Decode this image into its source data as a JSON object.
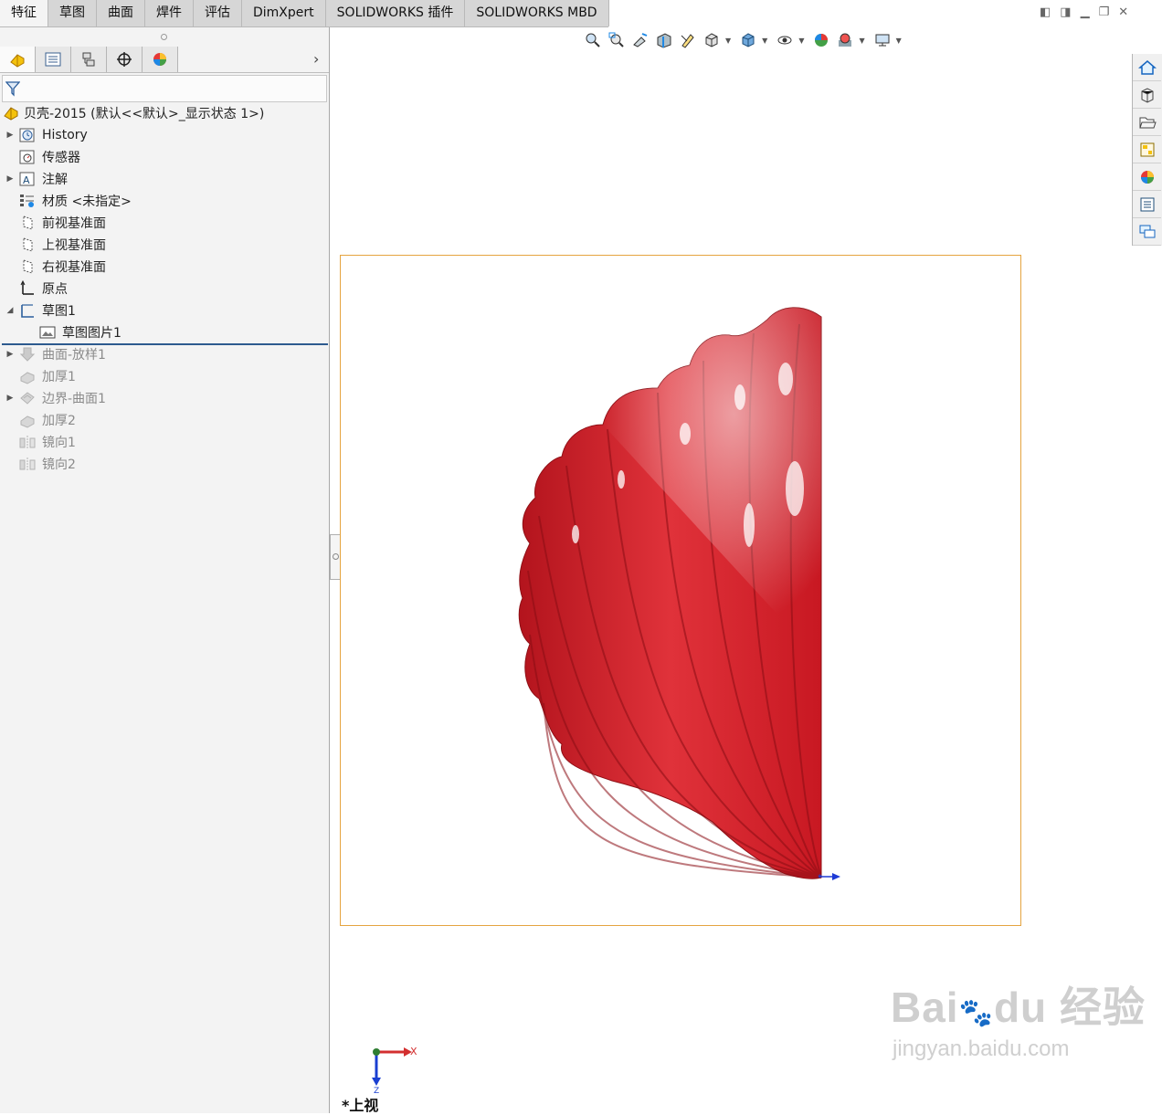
{
  "tabs": [
    "特征",
    "草图",
    "曲面",
    "焊件",
    "评估",
    "DimXpert",
    "SOLIDWORKS 插件",
    "SOLIDWORKS MBD"
  ],
  "active_tab": "特征",
  "panel_tabs": [
    "feature-manager-icon",
    "property-manager-icon",
    "configuration-manager-icon",
    "dimxpert-manager-icon",
    "display-manager-icon"
  ],
  "panel_expand_glyph": "›",
  "tree": {
    "root": "贝壳-2015  (默认<<默认>_显示状态 1>)",
    "items": [
      {
        "label": "History",
        "expand": true,
        "icon": "history-icon",
        "dim": false,
        "indent": 0
      },
      {
        "label": "传感器",
        "expand": false,
        "icon": "sensor-icon",
        "dim": false,
        "indent": 0
      },
      {
        "label": "注解",
        "expand": true,
        "icon": "annotation-icon",
        "dim": false,
        "indent": 0
      },
      {
        "label": "材质 <未指定>",
        "expand": false,
        "icon": "material-icon",
        "dim": false,
        "indent": 0
      },
      {
        "label": "前视基准面",
        "expand": false,
        "icon": "plane-icon",
        "dim": false,
        "indent": 0
      },
      {
        "label": "上视基准面",
        "expand": false,
        "icon": "plane-icon",
        "dim": false,
        "indent": 0
      },
      {
        "label": "右视基准面",
        "expand": false,
        "icon": "plane-icon",
        "dim": false,
        "indent": 0
      },
      {
        "label": "原点",
        "expand": false,
        "icon": "origin-icon",
        "dim": false,
        "indent": 0
      },
      {
        "label": "草图1",
        "expand": "open",
        "icon": "sketch-icon",
        "dim": false,
        "indent": 0
      },
      {
        "label": "草图图片1",
        "expand": false,
        "icon": "sketch-picture-icon",
        "dim": false,
        "indent": 1
      },
      {
        "label": "曲面-放样1",
        "expand": true,
        "icon": "surface-loft-icon",
        "dim": true,
        "indent": 0
      },
      {
        "label": "加厚1",
        "expand": false,
        "icon": "thicken-icon",
        "dim": true,
        "indent": 0
      },
      {
        "label": "边界-曲面1",
        "expand": true,
        "icon": "boundary-surface-icon",
        "dim": true,
        "indent": 0
      },
      {
        "label": "加厚2",
        "expand": false,
        "icon": "thicken-icon",
        "dim": true,
        "indent": 0
      },
      {
        "label": "镜向1",
        "expand": false,
        "icon": "mirror-icon",
        "dim": true,
        "indent": 0
      },
      {
        "label": "镜向2",
        "expand": false,
        "icon": "mirror-icon",
        "dim": true,
        "indent": 0
      }
    ]
  },
  "view": {
    "name": "*上视",
    "triad_x": "X",
    "triad_z": "Z"
  },
  "watermark": {
    "brand": "Bai",
    "brand2": "du",
    "cn": "经验",
    "url": "jingyan.baidu.com"
  },
  "colors": {
    "shell_red": "#d8262e",
    "frame_orange": "#e5a440",
    "rollback_blue": "#2d5a8e"
  }
}
